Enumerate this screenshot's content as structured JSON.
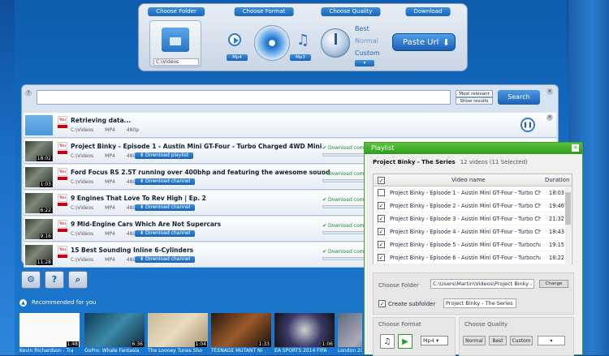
{
  "toolbar": {
    "choose_folder": "Choose Folder",
    "folder_path": "C:\\Videos",
    "choose_format": "Choose Format",
    "format_a": "Mp4",
    "format_b": "Mp3",
    "choose_quality": "Choose Quality",
    "quality_options": [
      "Best",
      "Normal",
      "Custom"
    ],
    "download": "Download",
    "paste_url": "Paste Url"
  },
  "search": {
    "sort_top": "Most relevant",
    "sort_bottom": "Show results",
    "button": "Search"
  },
  "rows": [
    {
      "title": "Retrieving data...",
      "path": "C:\\Videos",
      "format": "MP4",
      "quality": "480p",
      "duration": "",
      "button": "",
      "status": ""
    },
    {
      "title": "Project Binky - Episode 1 - Austin Mini GT-Four - Turbo Charged 4WD Mini",
      "path": "C:\\Videos",
      "format": "MP4",
      "quality": "480p",
      "duration": "18:02",
      "button": "Download playlist",
      "status": "Download comp"
    },
    {
      "title": "Ford Focus RS 2.5T running over 400bhp and featuring the awesome sound",
      "path": "C:\\Videos",
      "format": "MP4",
      "quality": "480p",
      "duration": "1:03",
      "button": "Download channel",
      "status": "Download comp"
    },
    {
      "title": "9 Engines That Love To Rev High | Ep. 2",
      "path": "C:\\Videos",
      "format": "MP4",
      "quality": "480p",
      "duration": "6:22",
      "button": "Download channel",
      "status": "Download comp"
    },
    {
      "title": "9 Mid-Engine Cars Which Are Not Supercars",
      "path": "C:\\Videos",
      "format": "MP4",
      "quality": "480p",
      "duration": "9:16",
      "button": "Download channel",
      "status": "Download comp"
    },
    {
      "title": "15 Best Sounding Inline 6-Cylinders",
      "path": "C:\\Videos",
      "format": "MP4",
      "quality": "480p",
      "duration": "11:28",
      "button": "Download channel",
      "status": "Download comp"
    }
  ],
  "recommended": {
    "label": "Recommended for you",
    "items": [
      {
        "title": "Kevin Richardson - Tra",
        "duration": "1:48"
      },
      {
        "title": "GoPro: Whale Fantasia",
        "duration": "6:36"
      },
      {
        "title": "The Looney Tunes Sho",
        "duration": "1:04"
      },
      {
        "title": "TEENAGE MUTANT NI",
        "duration": "1:33"
      },
      {
        "title": "EA SPORTS 2014 FIFA",
        "duration": "1:06"
      },
      {
        "title": "London 201",
        "duration": ""
      }
    ]
  },
  "playlist": {
    "title": "Playlist",
    "name": "Project Binky - The Series",
    "count": "12 videos (11 Selected)",
    "col_name": "Video name",
    "col_duration": "Duration",
    "items": [
      {
        "name": "Project Binky - Episode 1 - Austin Mini GT-Four - Turbo Cha",
        "duration": "18:03",
        "checked": false
      },
      {
        "name": "Project Binky - Episode 2 - Austin Mini GT-Four - Turbo Cha",
        "duration": "19:46",
        "checked": true
      },
      {
        "name": "Project Binky - Episode 3 - Austin Mini GT-Four - Turbo Cha",
        "duration": "21:32",
        "checked": true
      },
      {
        "name": "Project Binky - Episode 4 - Austin Mini GT-Four - Turbo Cha",
        "duration": "18:43",
        "checked": true
      },
      {
        "name": "Project Binky - Episode 5 - Austin Mini GT-Four - Turbochar",
        "duration": "19:15",
        "checked": true
      },
      {
        "name": "Project Binky - Episode 6 - Austin Mini GT-Four - Turbochar",
        "duration": "18:22",
        "checked": true
      }
    ],
    "choose_folder": "Choose Folder",
    "folder_path": "C:\\Users\\Martin\\Videos\\Project Binky -",
    "change": "Change",
    "create_subfolder": "Create subfolder",
    "subfolder_value": "Project Binky - The Series",
    "choose_format": "Choose Format",
    "format_value": "Mp4",
    "choose_quality": "Choose Quality",
    "quality_buttons": [
      "Normal",
      "Best",
      "Custom"
    ]
  }
}
